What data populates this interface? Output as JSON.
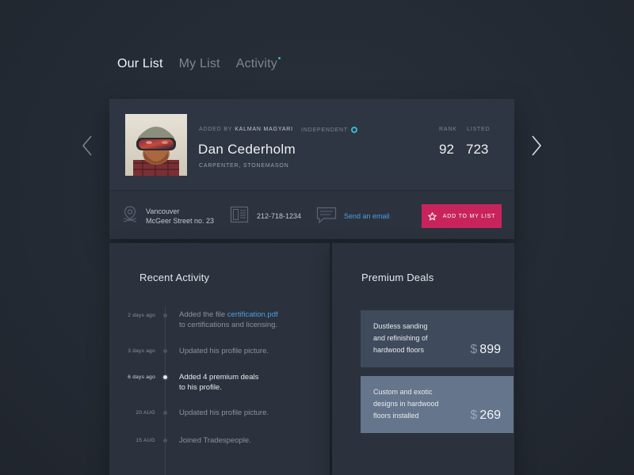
{
  "tabs": [
    {
      "label": "Our List",
      "active": true
    },
    {
      "label": "My List",
      "active": false
    },
    {
      "label": "Activity",
      "active": false,
      "has_dot": true
    }
  ],
  "profile": {
    "added_by_label": "ADDED BY",
    "added_by_name": "KALMAN MAGYARI",
    "status": "INDEPENDENT",
    "name": "Dan Cederholm",
    "roles": "CARPENTER,  STONEMASON",
    "rank_label": "RANK",
    "rank_value": "92",
    "listed_label": "LISTED",
    "listed_value": "723",
    "city": "Vancouver",
    "street": "McGeer Street no. 23",
    "phone": "212-718-1234",
    "email_link": "Send an email",
    "add_button": "ADD TO MY LIST"
  },
  "recent_activity": {
    "title": "Recent Activity",
    "items": [
      {
        "date": "2 days ago",
        "text_before": "Added the file ",
        "link": "certification.pdf",
        "text_after": "to certifications and licensing.",
        "active": false
      },
      {
        "date": "3 days ago",
        "text": "Updated his profile picture.",
        "active": false
      },
      {
        "date": "6 days ago",
        "line1": "Added 4 premium deals",
        "line2": "to his profile.",
        "active": true
      },
      {
        "date": "20 AUG",
        "text": "Updated his profile picture.",
        "active": false
      },
      {
        "date": "15 AUG",
        "text": "Joined Tradespeople.",
        "active": false
      }
    ]
  },
  "premium_deals": {
    "title": "Premium Deals",
    "currency": "$",
    "deals": [
      {
        "line1": "Dustless sanding",
        "line2": "and refinishing of",
        "line3": "hardwood floors",
        "price": "899",
        "color": "#3f4b5c"
      },
      {
        "line1": "Custom and exotic",
        "line2": "designs in hardwood",
        "line3": "floors installed",
        "price": "269",
        "color": "#65758b"
      }
    ]
  },
  "colors": {
    "accent_pink": "#c8245b",
    "accent_teal": "#39b7c9",
    "link_blue": "#4c9ee6"
  },
  "icons": [
    "map-pin-icon",
    "phone-card-icon",
    "chat-bubble-icon",
    "star-icon",
    "chevron-left-icon",
    "chevron-right-icon"
  ]
}
